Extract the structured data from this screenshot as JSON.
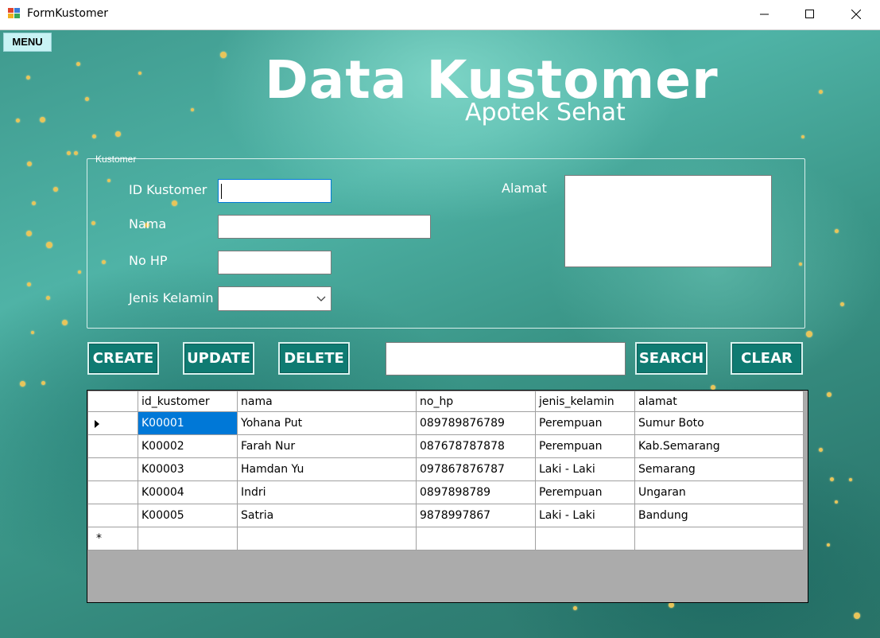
{
  "window": {
    "title": "FormKustomer"
  },
  "menu": {
    "label": "MENU"
  },
  "header": {
    "title": "Data Kustomer",
    "subtitle": "Apotek Sehat"
  },
  "form": {
    "group_label": "Kustomer",
    "id_label": "ID Kustomer",
    "id_value": "",
    "nama_label": "Nama",
    "nama_value": "",
    "nohp_label": "No HP",
    "nohp_value": "",
    "jk_label": "Jenis Kelamin",
    "jk_value": "",
    "alamat_label": "Alamat",
    "alamat_value": ""
  },
  "actions": {
    "create": "CREATE",
    "update": "UPDATE",
    "delete": "DELETE",
    "search_value": "",
    "search": "SEARCH",
    "clear": "CLEAR"
  },
  "grid": {
    "columns": [
      "id_kustomer",
      "nama",
      "no_hp",
      "jenis_kelamin",
      "alamat"
    ],
    "rows": [
      [
        "K00001",
        "Yohana Put",
        "089789876789",
        "Perempuan",
        "Sumur Boto"
      ],
      [
        "K00002",
        "Farah Nur",
        "087678787878",
        "Perempuan",
        "Kab.Semarang"
      ],
      [
        "K00003",
        "Hamdan Yu",
        "097867876787",
        "Laki - Laki",
        "Semarang"
      ],
      [
        "K00004",
        "Indri",
        "0897898789",
        "Perempuan",
        "Ungaran"
      ],
      [
        "K00005",
        "Satria",
        "9878997867",
        "Laki - Laki",
        "Bandung"
      ]
    ],
    "new_row_marker": "*"
  },
  "colors": {
    "accent": "#0f7b72",
    "selection": "#0078d7",
    "background": "#3f9a8e"
  }
}
